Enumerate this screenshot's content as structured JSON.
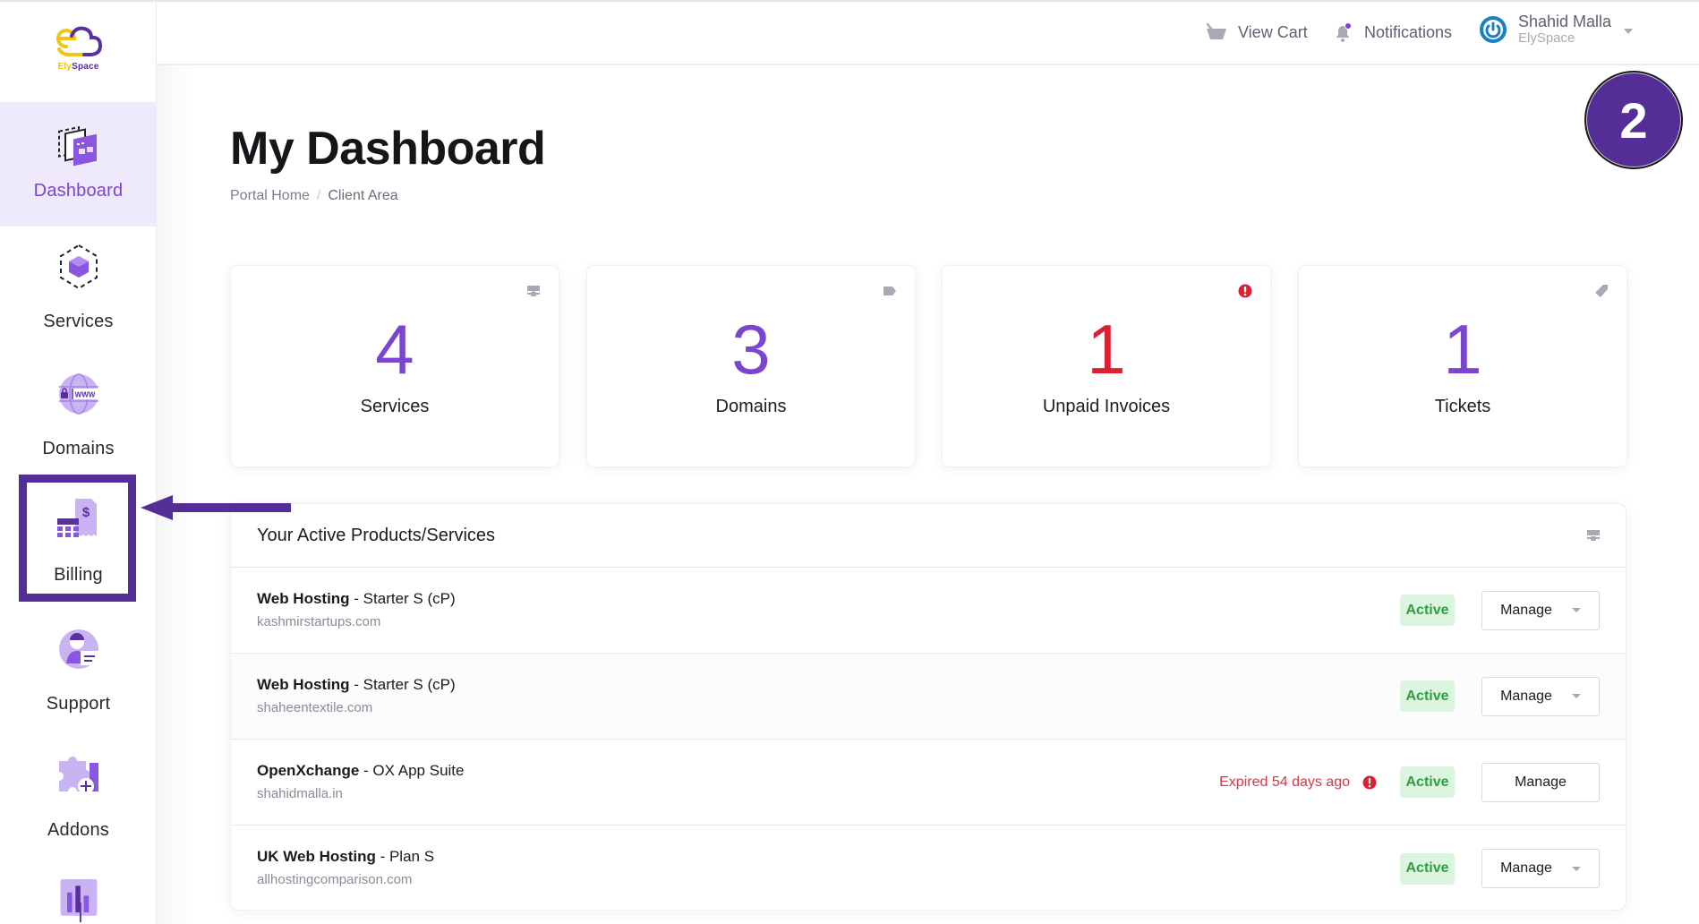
{
  "brand": {
    "name_part1": "Ely",
    "name_part2": "Space"
  },
  "sidebar": {
    "items": [
      {
        "label": "Dashboard",
        "icon": "dashboard-icon",
        "active": true
      },
      {
        "label": "Services",
        "icon": "cube-icon"
      },
      {
        "label": "Domains",
        "icon": "globe-www-icon"
      },
      {
        "label": "Billing",
        "icon": "billing-icon"
      },
      {
        "label": "Support",
        "icon": "support-icon"
      },
      {
        "label": "Addons",
        "icon": "puzzle-icon"
      },
      {
        "label": "",
        "icon": "chart-icon"
      }
    ]
  },
  "header": {
    "cart_label": "View Cart",
    "notifications_label": "Notifications",
    "user_name": "Shahid Malla",
    "user_org": "ElySpace"
  },
  "annotation": {
    "step_number": "2"
  },
  "page": {
    "title": "My Dashboard",
    "breadcrumb": [
      "Portal Home",
      "Client Area"
    ]
  },
  "stats": [
    {
      "value": "4",
      "label": "Services",
      "icon": "server-icon",
      "color": "#7b45d0"
    },
    {
      "value": "3",
      "label": "Domains",
      "icon": "tag-icon",
      "color": "#7b45d0"
    },
    {
      "value": "1",
      "label": "Unpaid Invoices",
      "icon": "alert-icon",
      "color": "#dc2032"
    },
    {
      "value": "1",
      "label": "Tickets",
      "icon": "ticket-icon",
      "color": "#7b45d0"
    }
  ],
  "products_panel": {
    "title": "Your Active Products/Services",
    "rows": [
      {
        "product": "Web Hosting",
        "plan": " - Starter S (cP)",
        "domain": "kashmirstartups.com",
        "status": "Active",
        "action": "Manage",
        "has_dropdown": true,
        "notice": ""
      },
      {
        "product": "Web Hosting",
        "plan": " - Starter S (cP)",
        "domain": "shaheentextile.com",
        "status": "Active",
        "action": "Manage",
        "has_dropdown": true,
        "notice": ""
      },
      {
        "product": "OpenXchange",
        "plan": " - OX App Suite",
        "domain": "shahidmalla.in",
        "status": "Active",
        "action": "Manage",
        "has_dropdown": false,
        "notice": "Expired 54 days ago"
      },
      {
        "product": "UK Web Hosting",
        "plan": " - Plan S",
        "domain": "allhostingcomparison.com",
        "status": "Active",
        "action": "Manage",
        "has_dropdown": true,
        "notice": ""
      }
    ]
  },
  "colors": {
    "accent": "#7b45d0",
    "annotation": "#552d96",
    "danger": "#dc3545",
    "success_bg": "#dcf5df",
    "success_text": "#2f9e44"
  }
}
